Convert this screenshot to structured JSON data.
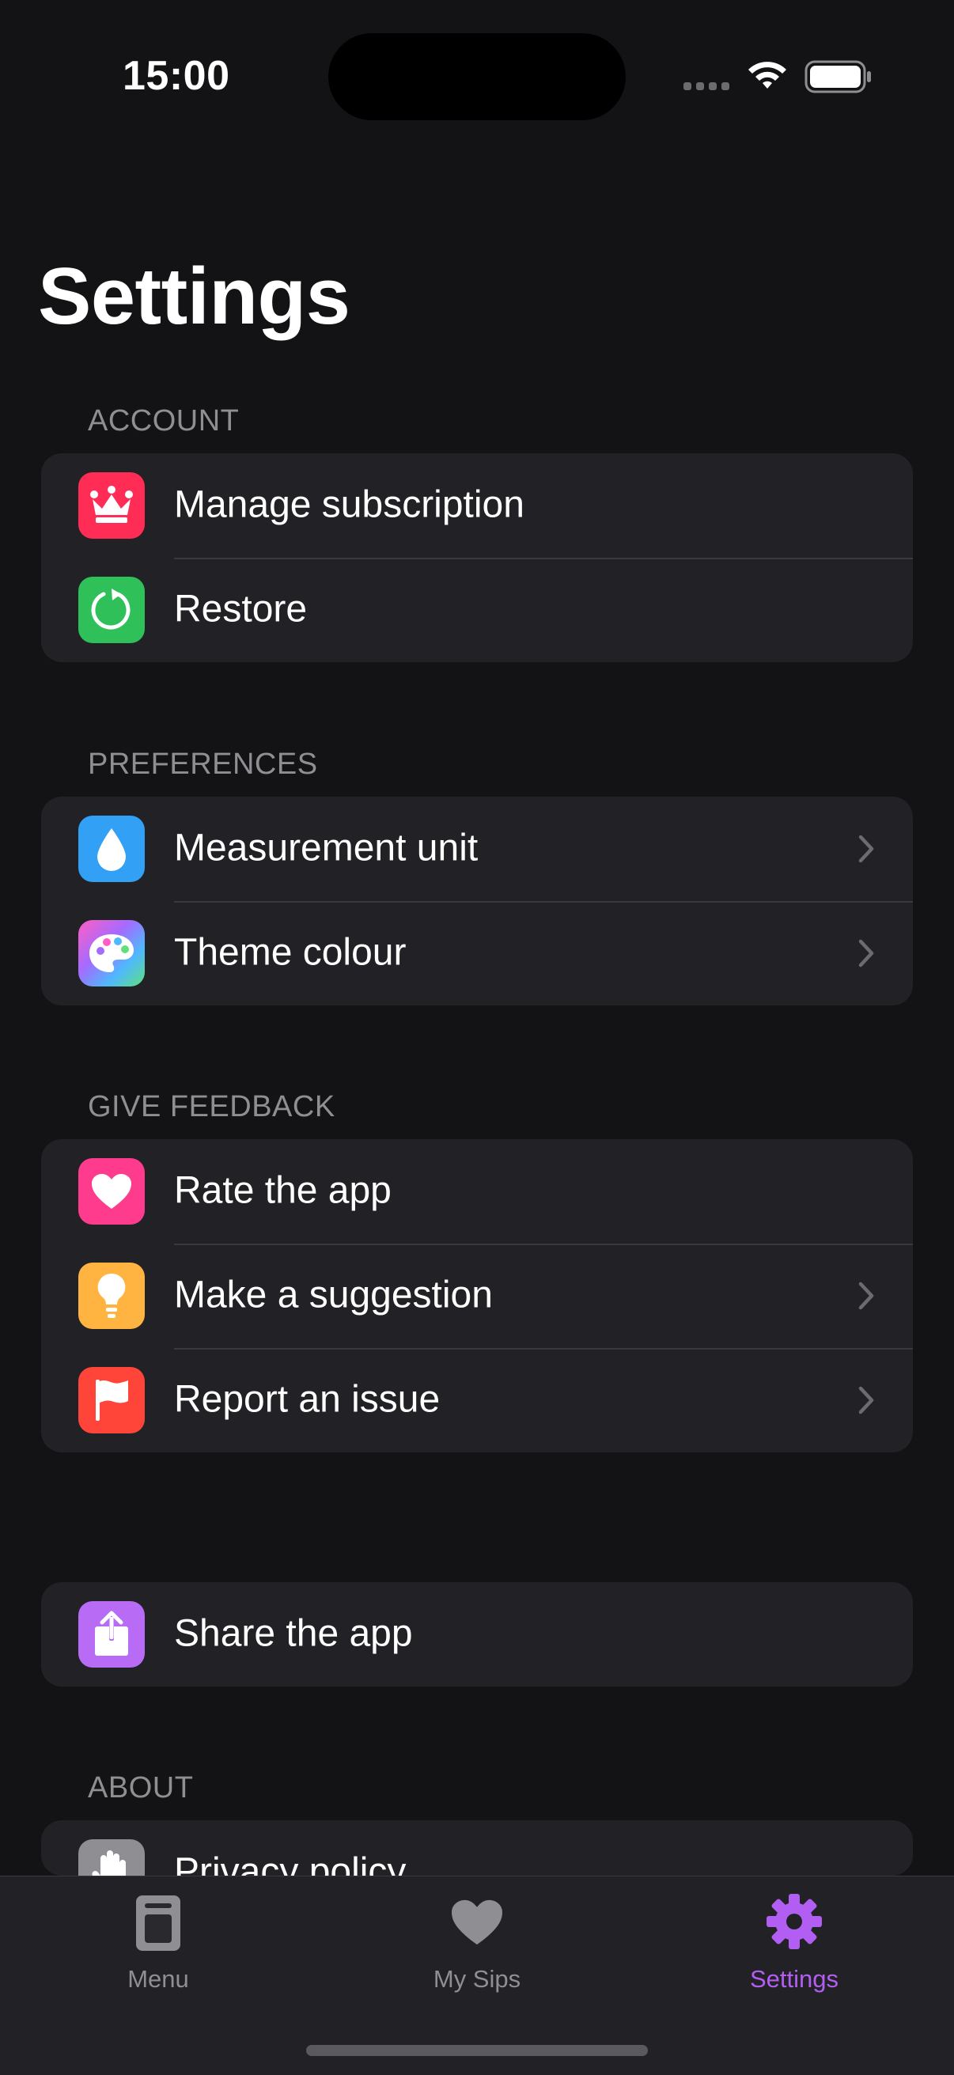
{
  "status_bar": {
    "time": "15:00"
  },
  "page_title": "Settings",
  "sections": {
    "account": {
      "header": "ACCOUNT",
      "items": [
        {
          "label": "Manage subscription",
          "icon": "crown-icon",
          "color": "#ff2d55"
        },
        {
          "label": "Restore",
          "icon": "restore-icon",
          "color": "#30c05a"
        }
      ]
    },
    "preferences": {
      "header": "PREFERENCES",
      "items": [
        {
          "label": "Measurement unit",
          "icon": "drop-icon",
          "color": "#32a0f5"
        },
        {
          "label": "Theme colour",
          "icon": "palette-icon",
          "color": "gradient"
        }
      ]
    },
    "feedback": {
      "header": "GIVE FEEDBACK",
      "items": [
        {
          "label": "Rate the app",
          "icon": "heart-icon",
          "color": "#ff3b8e"
        },
        {
          "label": "Make a suggestion",
          "icon": "lightbulb-icon",
          "color": "#ffb340"
        },
        {
          "label": "Report an issue",
          "icon": "flag-icon",
          "color": "#ff453a"
        }
      ]
    },
    "share": {
      "items": [
        {
          "label": "Share the app",
          "icon": "share-icon",
          "color": "#b86cf5"
        }
      ]
    },
    "about": {
      "header": "ABOUT",
      "items": [
        {
          "label": "Privacy policy",
          "icon": "hand-icon",
          "color": "#8e8e93"
        }
      ]
    }
  },
  "tabbar": {
    "tabs": [
      {
        "label": "Menu",
        "icon": "menu-card-icon",
        "active": false
      },
      {
        "label": "My Sips",
        "icon": "heart-icon",
        "active": false
      },
      {
        "label": "Settings",
        "icon": "gear-icon",
        "active": true
      }
    ],
    "active_color": "#b35ef2"
  }
}
